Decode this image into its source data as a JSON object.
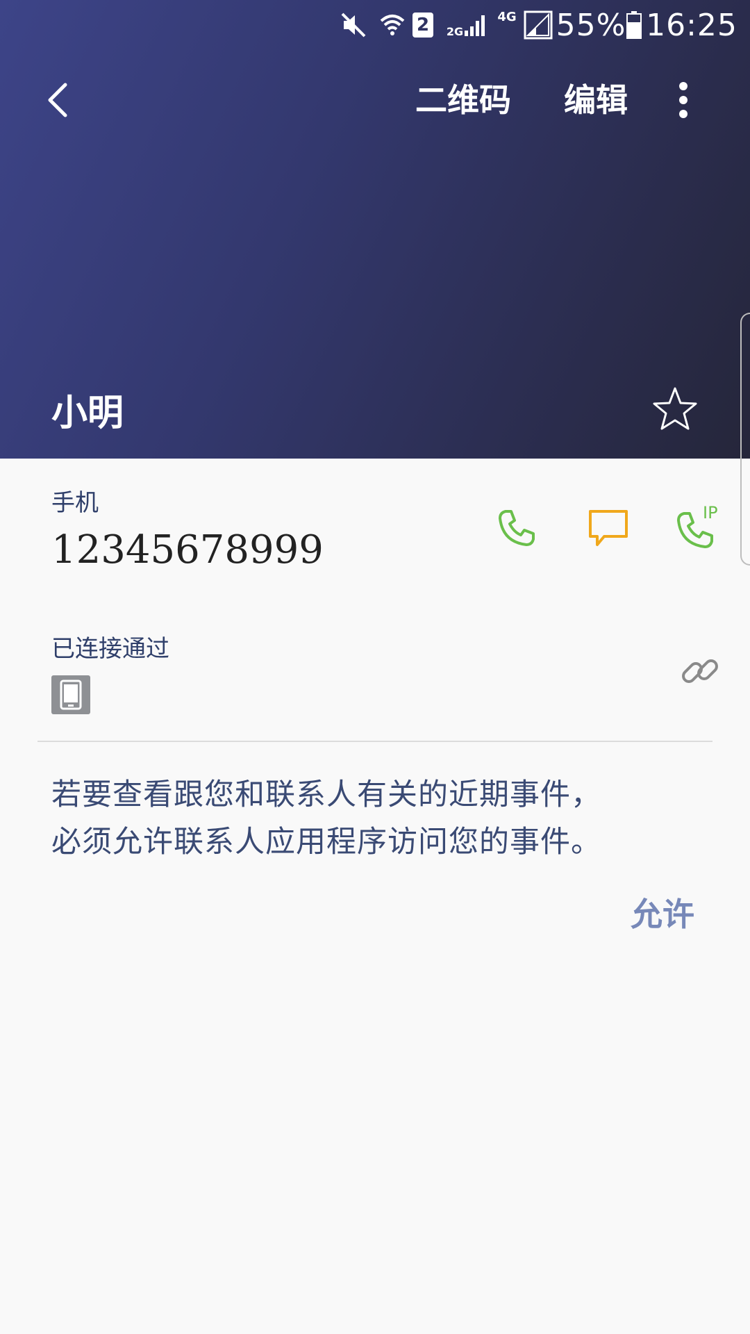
{
  "status_bar": {
    "sim_badge": "2",
    "network_2g": "2G",
    "network_4g": "4G",
    "battery_percent": "55%",
    "time": "16:25",
    "icons": [
      "mute-icon",
      "wifi-icon",
      "sim2-icon",
      "signal-2g-icon",
      "signal-4g-icon",
      "battery-icon"
    ]
  },
  "action_bar": {
    "back_icon": "back-arrow-icon",
    "qr_label": "二维码",
    "edit_label": "编辑",
    "more_icon": "more-vert-icon"
  },
  "contact": {
    "name": "小明",
    "favorite_icon": "star-outline-icon"
  },
  "phone": {
    "label": "手机",
    "number": "12345678999",
    "actions": [
      {
        "icon": "phone-icon",
        "color": "#6abf4b"
      },
      {
        "icon": "message-icon",
        "color": "#f0a81c"
      },
      {
        "icon": "ip-call-icon",
        "color": "#6abf4b",
        "badge": "IP"
      }
    ]
  },
  "connected": {
    "label": "已连接通过",
    "device_icon": "tablet-icon",
    "link_icon": "link-icon"
  },
  "events_notice": {
    "line1": "若要查看跟您和联系人有关的近期事件，",
    "line2": "必须允许联系人应用程序访问您的事件。",
    "allow_label": "允许"
  },
  "colors": {
    "header_gradient_start": "#3d4488",
    "header_gradient_end": "#25263a",
    "accent_text": "#2f3f6a",
    "allow_text": "#7788b8",
    "call_green": "#6abf4b",
    "message_orange": "#f0a81c"
  }
}
